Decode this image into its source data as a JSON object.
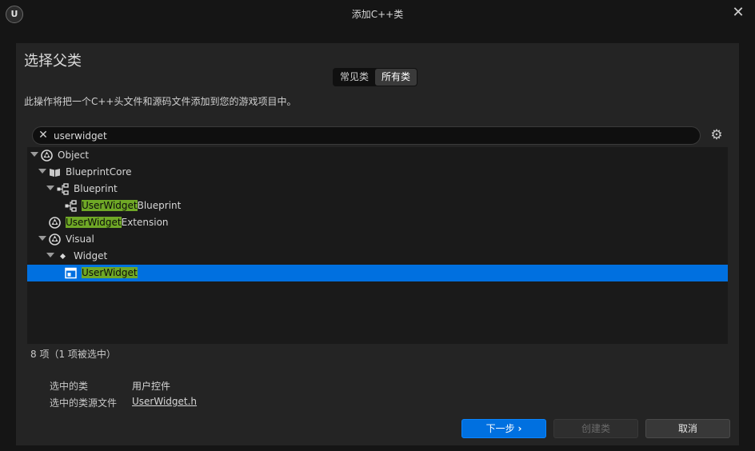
{
  "window": {
    "title": "添加C++类",
    "logo": "unreal-logo",
    "close_icon": "close-icon"
  },
  "heading": "选择父类",
  "tabs": [
    {
      "label": "常见类",
      "active": false
    },
    {
      "label": "所有类",
      "active": true
    }
  ],
  "description": "此操作将把一个C++头文件和源码文件添加到您的游戏项目中。",
  "search": {
    "value": "userwidget",
    "placeholder": ""
  },
  "tree": [
    {
      "prefix": "",
      "match": "",
      "suffix": "Object",
      "icon": "uobject-icon",
      "expanded": true
    },
    {
      "prefix": "",
      "match": "",
      "suffix": "BlueprintCore",
      "icon": "book-icon",
      "expanded": true
    },
    {
      "prefix": "",
      "match": "",
      "suffix": "Blueprint",
      "icon": "blueprint-icon",
      "expanded": true
    },
    {
      "prefix": "",
      "match": "UserWidget",
      "suffix": "Blueprint",
      "icon": "blueprint-icon",
      "expanded": null
    },
    {
      "prefix": "",
      "match": "UserWidget",
      "suffix": "Extension",
      "icon": "uobject-icon",
      "expanded": null
    },
    {
      "prefix": "",
      "match": "",
      "suffix": "Visual",
      "icon": "uobject-icon",
      "expanded": true
    },
    {
      "prefix": "",
      "match": "",
      "suffix": "Widget",
      "icon": "diamond-icon",
      "expanded": true
    },
    {
      "prefix": "",
      "match": "UserWidget",
      "suffix": "",
      "icon": "user-widget-icon",
      "expanded": null,
      "selected": true
    }
  ],
  "count_text": "8 项（1 项被选中）",
  "selected_info": {
    "class_label": "选中的类",
    "class_value": "用户控件",
    "source_label": "选中的类源文件",
    "source_value": "UserWidget.h"
  },
  "buttons": {
    "next": "下一步",
    "create": "创建类",
    "cancel": "取消"
  },
  "colors": {
    "accent": "#0070e0",
    "highlight": "#6fa826"
  }
}
